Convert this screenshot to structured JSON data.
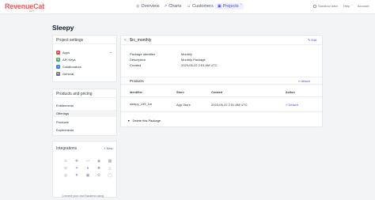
{
  "header": {
    "logo_text": "RevenueCat",
    "logo_sub": "BETA",
    "nav": [
      {
        "label": "Overview",
        "icon": "◎"
      },
      {
        "label": "Charts",
        "icon": "↗"
      },
      {
        "label": "Customers",
        "icon": "☺"
      },
      {
        "label": "Projects",
        "icon": "▣",
        "caret": "ˇ"
      }
    ],
    "sandbox_label": "Sandbox data",
    "help_label": "Help",
    "help_caret": "ˇ",
    "account_label": "Account"
  },
  "page": {
    "title": "Sleepy"
  },
  "sidebar": {
    "project_settings": {
      "title": "Project settings",
      "items": [
        {
          "label": "Apps",
          "color": "#ef4444",
          "glyph": "■"
        },
        {
          "label": "API Keys",
          "color": "#22c55e",
          "glyph": "⚒"
        },
        {
          "label": "Collaborators",
          "color": "#3b82f6",
          "glyph": "☺"
        },
        {
          "label": "General",
          "color": "#6b7280",
          "glyph": "⚙"
        }
      ]
    },
    "products_pricing": {
      "title": "Products and pricing",
      "items": [
        "Entitlements",
        "Offerings",
        "Products",
        "Experiments"
      ],
      "selected": "Offerings"
    },
    "integrations": {
      "title": "Integrations",
      "new_label": "+ New",
      "icons": [
        "amplitude-icon",
        "appsflyer-icon",
        "branch-icon",
        "facebook-icon",
        "mixpanel-icon",
        "segment-icon",
        "twitter-icon",
        "apple-icon",
        "slack-icon",
        "google-icon",
        "onesignal-icon",
        "airship-icon",
        "braze-icon",
        "firebase-icon",
        "clevertap-icon"
      ],
      "footer_text": "Connect your own backend using"
    }
  },
  "package": {
    "back_icon": "<",
    "title": "$rc_monthly",
    "edit_label": "Edit",
    "properties": [
      {
        "label": "Package Identifier",
        "value": "Monthly"
      },
      {
        "label": "Description",
        "value": "Monthly Package"
      },
      {
        "label": "Created",
        "value": "2023-05-22 2:03 AM UTC"
      }
    ],
    "products_title": "Products",
    "attach_label": "Attach",
    "columns": [
      "Identifier",
      "Store",
      "Created",
      "Action"
    ],
    "rows": [
      {
        "identifier": "sleepy_199_1m",
        "store": "App Store",
        "created": "2023-05-22 2:51 AM UTC",
        "action": "Detach"
      }
    ],
    "delete_label": "Delete this Package"
  }
}
